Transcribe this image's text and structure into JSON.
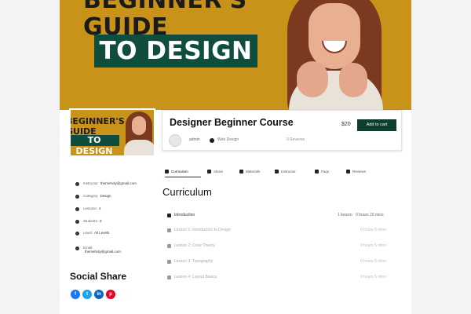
{
  "hero": {
    "headline_line1": "BEGINNER'S",
    "headline_line2": "GUIDE",
    "pill": "TO DESIGN"
  },
  "thumbnail": {
    "line1": "BEGINNER'S",
    "line2": "GUIDE",
    "pill": "TO DESIGN"
  },
  "course": {
    "title": "Designer Beginner Course",
    "price": "$20",
    "add_to_cart": "Add to cart",
    "author": "admin",
    "category": "Web Design",
    "rating": "0 Reviews"
  },
  "tabs": [
    {
      "label": "Curriculum",
      "icon": "curriculum-icon"
    },
    {
      "label": "About",
      "icon": "about-icon"
    },
    {
      "label": "Materials",
      "icon": "materials-icon"
    },
    {
      "label": "Instructor",
      "icon": "instructor-icon"
    },
    {
      "label": "Faqs",
      "icon": "faq-icon"
    },
    {
      "label": "Reviews",
      "icon": "reviews-icon"
    }
  ],
  "curriculum": {
    "title": "Curriculum",
    "section": "Introduction",
    "section_lessons": "1 lesson",
    "section_duration": "0 hours 15 mins",
    "lessons": [
      {
        "title": "Lesson 1: Introduction to Design",
        "meta": "0 hours 5 mins"
      },
      {
        "title": "Lesson 2: Color Theory",
        "meta": "0 hours 5 mins"
      },
      {
        "title": "Lesson 3: Typography",
        "meta": "0 hours 5 mins"
      },
      {
        "title": "Lesson 4: Layout Basics",
        "meta": "0 hours 5 mins"
      }
    ]
  },
  "sidebar": {
    "info": [
      {
        "icon": "user-icon",
        "label": "Instructor:",
        "value": "themeholy@gmail.com"
      },
      {
        "icon": "category-icon",
        "label": "Category:",
        "value": "Design"
      },
      {
        "icon": "lessons-icon",
        "label": "Lessons:",
        "value": "4"
      },
      {
        "icon": "students-icon",
        "label": "Students:",
        "value": "0"
      },
      {
        "icon": "level-icon",
        "label": "Level:",
        "value": "All Levels"
      },
      {
        "icon": "email-icon",
        "label": "Email:",
        "value": "themeholy@gmail.com"
      }
    ],
    "social_title": "Social Share",
    "social": [
      {
        "icon": "facebook-icon",
        "glyph": "f",
        "color": "#1877f2"
      },
      {
        "icon": "twitter-icon",
        "glyph": "t",
        "color": "#1da1f2"
      },
      {
        "icon": "linkedin-icon",
        "glyph": "in",
        "color": "#0a66c2"
      },
      {
        "icon": "pinterest-icon",
        "glyph": "p",
        "color": "#e60023"
      }
    ]
  }
}
